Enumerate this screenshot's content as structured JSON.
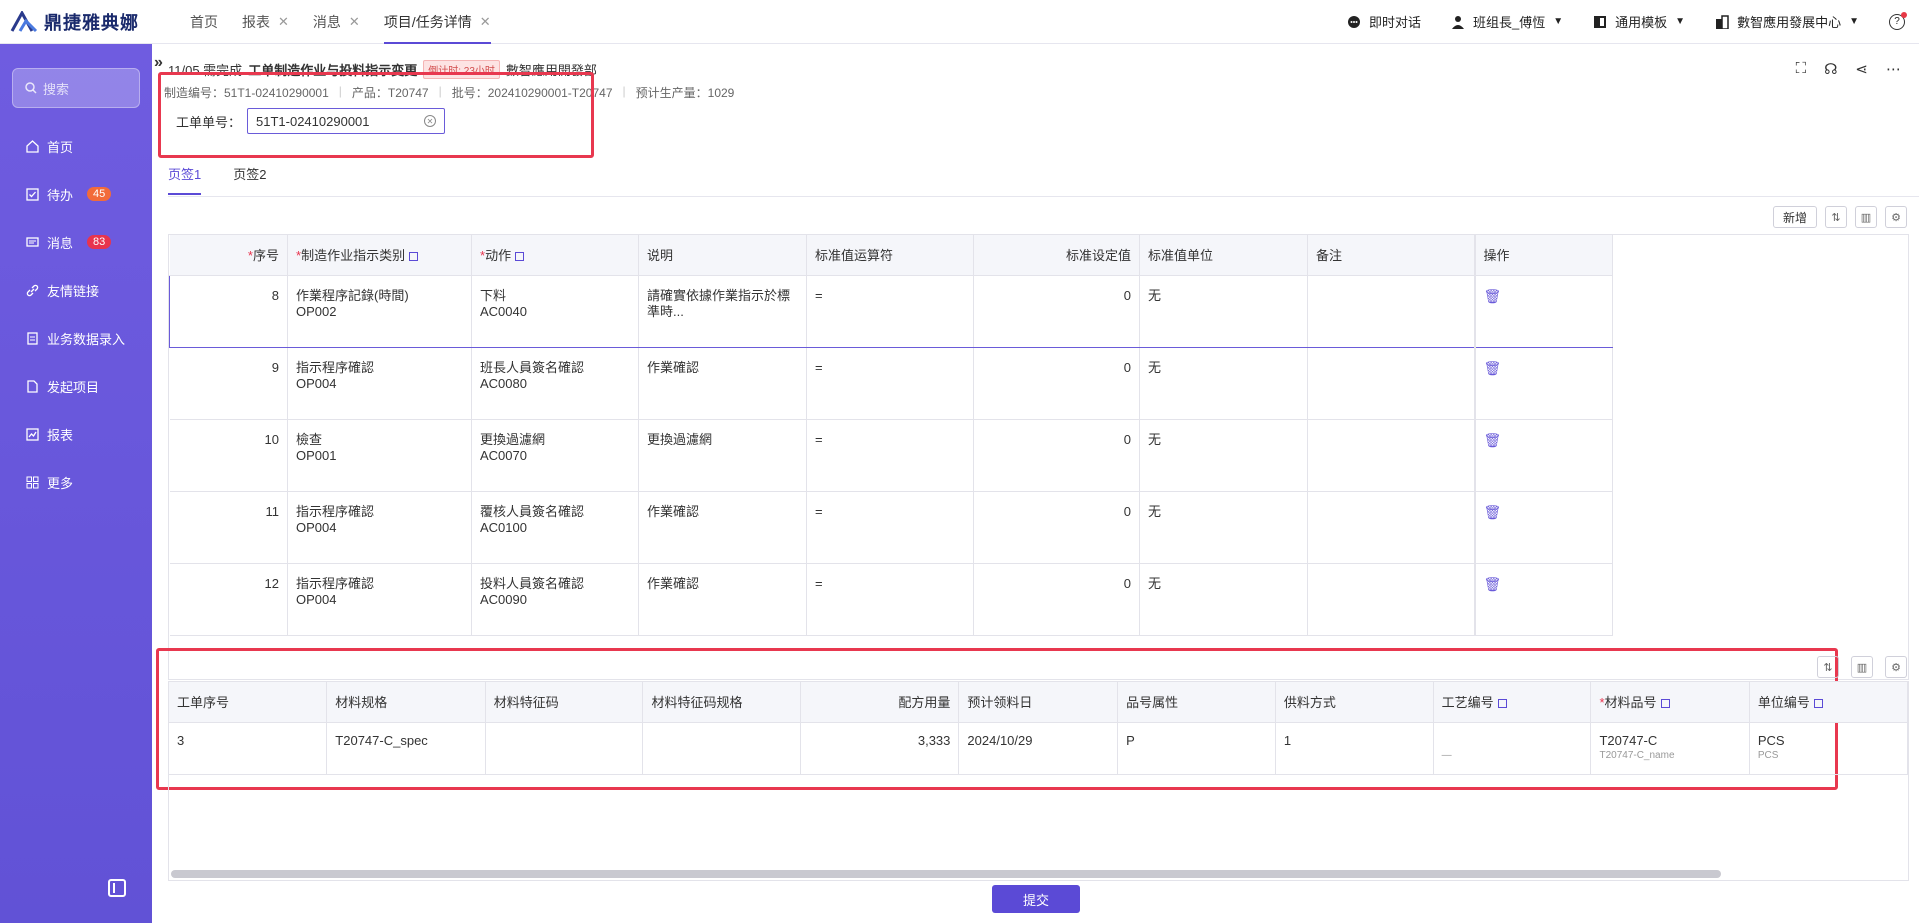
{
  "app": {
    "logo_text": "鼎捷雅典娜"
  },
  "top_tabs": [
    {
      "label": "首页",
      "closable": false
    },
    {
      "label": "报表",
      "closable": true
    },
    {
      "label": "消息",
      "closable": true
    },
    {
      "label": "项目/任务详情",
      "closable": true,
      "active": true
    }
  ],
  "top_right": {
    "chat": "即时对话",
    "user": "班组長_傅恆",
    "template": "通用模板",
    "org": "數智應用發展中心"
  },
  "sidebar": {
    "search_placeholder": "搜索",
    "items": [
      {
        "label": "首页",
        "icon": "home-icon"
      },
      {
        "label": "待办",
        "icon": "todo-icon",
        "badge": "45"
      },
      {
        "label": "消息",
        "icon": "message-icon",
        "badge": "83"
      },
      {
        "label": "友情链接",
        "icon": "link-icon"
      },
      {
        "label": "业务数据录入",
        "icon": "data-entry-icon"
      },
      {
        "label": "发起项目",
        "icon": "project-icon"
      },
      {
        "label": "报表",
        "icon": "report-icon"
      },
      {
        "label": "更多",
        "icon": "more-grid-icon"
      }
    ]
  },
  "task": {
    "date_prefix": "11/05 需完成",
    "title": "工单制造作业与投料指示变更",
    "timer": "倒计时: 23小时",
    "dept": "數智應用開發部",
    "meta": [
      "制造编号：51T1-02410290001",
      "产品：T20747",
      "批号：202410290001-T20747",
      "预计生产量：1029"
    ],
    "wo_label": "工单单号：",
    "wo_value": "51T1-02410290001"
  },
  "page_tabs": [
    "页签1",
    "页签2"
  ],
  "toolbar": {
    "new_label": "新增"
  },
  "table1": {
    "headers": [
      "序号",
      "制造作业指示类别",
      "动作",
      "说明",
      "标准值运算符",
      "标准设定值",
      "标准值单位",
      "备注",
      "操作"
    ],
    "rows": [
      {
        "seq": "8",
        "cat": "作業程序記錄(時間)",
        "cat_code": "OP002",
        "act": "下料",
        "act_code": "AC0040",
        "desc": "請確實依據作業指示於標準時...",
        "op": "=",
        "val": "0",
        "unit": "无",
        "note": ""
      },
      {
        "seq": "9",
        "cat": "指示程序確認",
        "cat_code": "OP004",
        "act": "班長人員簽名確認",
        "act_code": "AC0080",
        "desc": "作業確認",
        "op": "=",
        "val": "0",
        "unit": "无",
        "note": ""
      },
      {
        "seq": "10",
        "cat": "檢查",
        "cat_code": "OP001",
        "act": "更換過濾網",
        "act_code": "AC0070",
        "desc": "更換過濾網",
        "op": "=",
        "val": "0",
        "unit": "无",
        "note": ""
      },
      {
        "seq": "11",
        "cat": "指示程序確認",
        "cat_code": "OP004",
        "act": "覆核人員簽名確認",
        "act_code": "AC0100",
        "desc": "作業確認",
        "op": "=",
        "val": "0",
        "unit": "无",
        "note": ""
      },
      {
        "seq": "12",
        "cat": "指示程序確認",
        "cat_code": "OP004",
        "act": "投料人員簽名確認",
        "act_code": "AC0090",
        "desc": "作業確認",
        "op": "=",
        "val": "0",
        "unit": "无",
        "note": ""
      }
    ]
  },
  "table2": {
    "headers": [
      "工单序号",
      "材料规格",
      "材料特征码",
      "材料特征码规格",
      "配方用量",
      "预计领料日",
      "品号属性",
      "供料方式",
      "工艺编号",
      "材料品号",
      "单位编号"
    ],
    "rows": [
      {
        "seq": "3",
        "spec": "T20747-C_spec",
        "feat": "",
        "feat_spec": "",
        "qty": "3,333",
        "date": "2024/10/29",
        "attr": "P",
        "supply": "1",
        "proc": "",
        "proc_sub": "—",
        "item": "T20747-C",
        "item_sub": "T20747-C_name",
        "unit": "PCS",
        "unit_sub": "PCS"
      }
    ]
  },
  "submit_label": "提交"
}
